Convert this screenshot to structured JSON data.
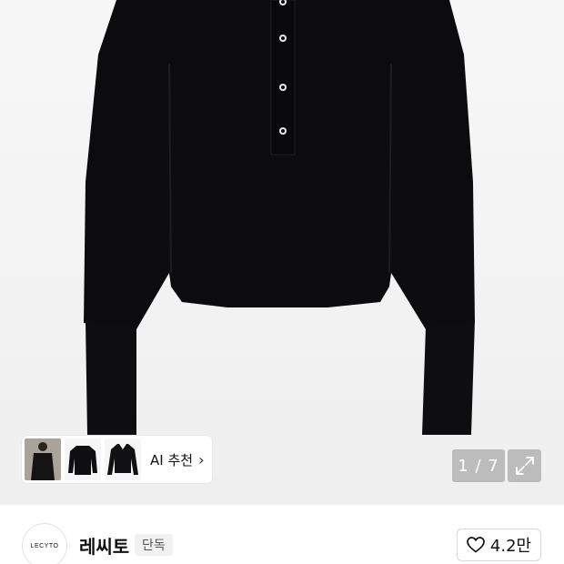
{
  "gallery": {
    "counter": "1 / 7",
    "ai_recommend_label": "AI 추천",
    "ai_chevron": "›",
    "thumbnails": [
      "model-photo-thumbnail",
      "black-top-thumbnail",
      "black-shirt-thumbnail"
    ]
  },
  "brand": {
    "logo_text": "LECYTO",
    "name": "레씨토",
    "badge": "단독"
  },
  "like": {
    "count": "4.2만"
  },
  "colors": {
    "garment": "#0c0c0f",
    "overlay_button": "#bcbcbc",
    "background": "#f4f4f4"
  }
}
